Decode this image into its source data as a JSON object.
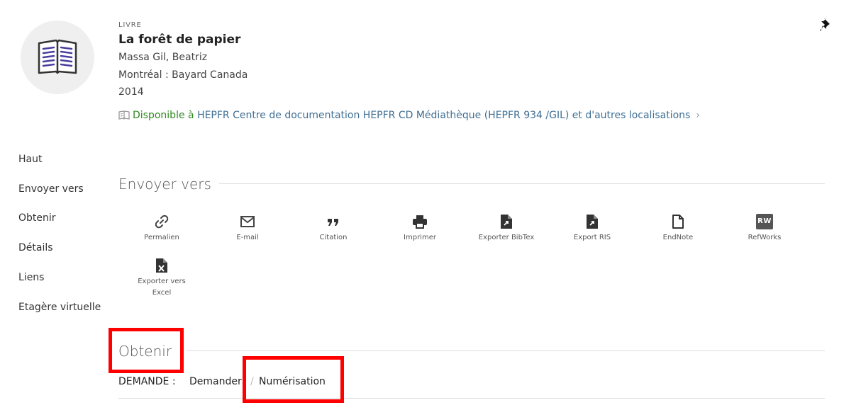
{
  "record": {
    "type_label": "LIVRE",
    "title": "La forêt de papier",
    "author": "Massa Gil, Beatriz",
    "publisher": "Montréal : Bayard Canada",
    "year": "2014",
    "availability_status": "Disponible à ",
    "availability_location": "HEPFR Centre de documentation  HEPFR CD Médiathèque (HEPFR 934 /GIL) et d'autres localisations",
    "availability_chevron": "›"
  },
  "nav": {
    "items": [
      "Haut",
      "Envoyer vers",
      "Obtenir",
      "Détails",
      "Liens",
      "Etagère virtuelle"
    ]
  },
  "send_to": {
    "title": "Envoyer vers",
    "actions": [
      {
        "label": "Permalien",
        "icon": "link-icon"
      },
      {
        "label": "E-mail",
        "icon": "mail-icon"
      },
      {
        "label": "Citation",
        "icon": "quote-icon"
      },
      {
        "label": "Imprimer",
        "icon": "print-icon"
      },
      {
        "label": "Exporter BibTex",
        "icon": "export-file-icon"
      },
      {
        "label": "Export RIS",
        "icon": "export-file-icon"
      },
      {
        "label": "EndNote",
        "icon": "file-icon"
      },
      {
        "label": "RefWorks",
        "icon": "refworks-icon",
        "badge": "RW"
      },
      {
        "label": "Exporter vers Excel",
        "icon": "excel-icon"
      }
    ]
  },
  "get_it": {
    "title": "Obtenir",
    "request_label": "DEMANDE :",
    "request_option": "Demander",
    "separator": "/",
    "scan_option": "Numérisation"
  },
  "colors": {
    "available_green": "#2f8a1e",
    "link_blue": "#3f6f94",
    "highlight_red": "#ff0000",
    "book_icon_purple": "#4a3f9f"
  }
}
